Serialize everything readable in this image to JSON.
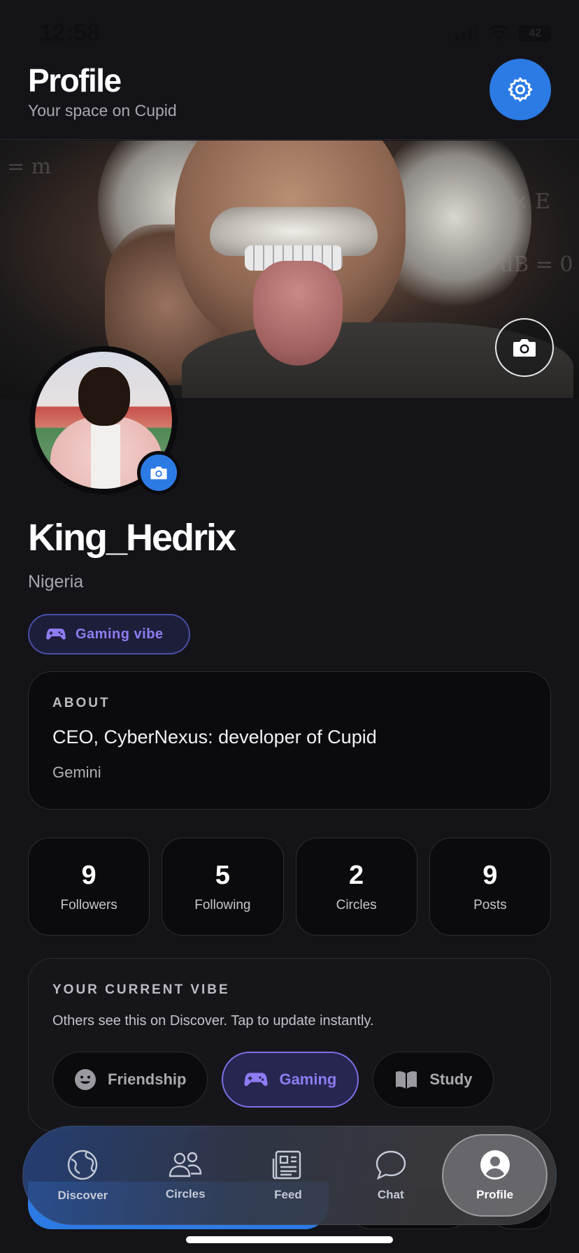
{
  "status_bar": {
    "time": "12:58",
    "battery": "42"
  },
  "header": {
    "title": "Profile",
    "subtitle": "Your space on Cupid"
  },
  "profile": {
    "username": "King_Hedrix",
    "location": "Nigeria",
    "vibe_chip": "Gaming vibe"
  },
  "about": {
    "heading": "ABOUT",
    "bio": "CEO, CyberNexus: developer of Cupid",
    "zodiac": "Gemini"
  },
  "stats": [
    {
      "value": "9",
      "label": "Followers"
    },
    {
      "value": "5",
      "label": "Following"
    },
    {
      "value": "2",
      "label": "Circles"
    },
    {
      "value": "9",
      "label": "Posts"
    }
  ],
  "current_vibe": {
    "heading": "YOUR CURRENT VIBE",
    "description": "Others see this on Discover. Tap to update instantly.",
    "options": [
      {
        "label": "Friendship",
        "icon": "smile-icon",
        "selected": false
      },
      {
        "label": "Gaming",
        "icon": "gamepad-icon",
        "selected": true
      },
      {
        "label": "Study",
        "icon": "book-icon",
        "selected": false
      }
    ]
  },
  "tabbar": {
    "items": [
      {
        "label": "Discover",
        "icon": "globe-icon"
      },
      {
        "label": "Circles",
        "icon": "people-icon"
      },
      {
        "label": "Feed",
        "icon": "newspaper-icon"
      },
      {
        "label": "Chat",
        "icon": "chat-bubble-icon"
      },
      {
        "label": "Profile",
        "icon": "user-circle-icon",
        "active": true
      }
    ]
  },
  "colors": {
    "background": "#141418",
    "accent_blue": "#2c7be5",
    "accent_purple": "#8e7cf2",
    "card": "#0b0b0d"
  }
}
